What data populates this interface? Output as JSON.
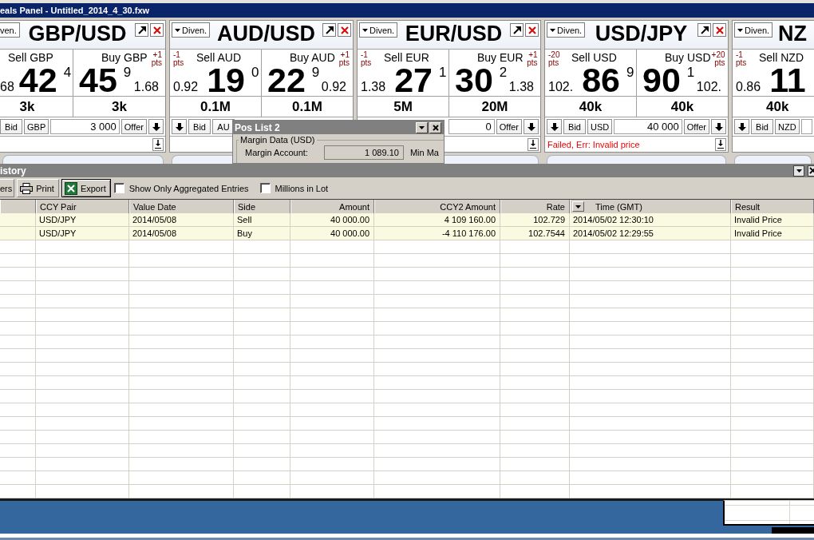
{
  "window": {
    "title": "eals Panel - Untitled_2014_4_30.fxw"
  },
  "tiles": [
    {
      "dropdown": "ven.",
      "pair": "GBP/USD",
      "header_buttons": [
        {
          "kind": "popout"
        },
        {
          "kind": "close"
        }
      ],
      "sell": {
        "label": "Sell GBP",
        "prefix": "68",
        "figure": "42",
        "pip": "4",
        "amount": "3k"
      },
      "buy": {
        "label": "Buy GBP",
        "pts": "+1 pts",
        "figure": "45",
        "pip": "9",
        "suffix": "1.68",
        "amount": "3k"
      },
      "controls": [
        {
          "kind": "button",
          "label": "Bid"
        },
        {
          "kind": "button",
          "label": "GBP"
        },
        {
          "kind": "field",
          "value": "3 000"
        },
        {
          "kind": "button",
          "label": "Offer"
        },
        {
          "kind": "arrow"
        }
      ],
      "status": [
        {
          "kind": "arrow"
        }
      ]
    },
    {
      "dropdown": "Diven.",
      "pair": "AUD/USD",
      "header_buttons": [
        {
          "kind": "popout"
        },
        {
          "kind": "close"
        }
      ],
      "sell": {
        "pts": "-1 pts",
        "label": "Sell AUD",
        "prefix": "0.92",
        "figure": "19",
        "pip": "0",
        "amount": "0.1M"
      },
      "buy": {
        "label": "Buy AUD",
        "pts": "+1 pts",
        "figure": "22",
        "pip": "9",
        "suffix": "0.92",
        "amount": "0.1M"
      },
      "controls": [
        {
          "kind": "arrow"
        },
        {
          "kind": "button",
          "label": "Bid"
        },
        {
          "kind": "button",
          "label": "AU"
        }
      ]
    },
    {
      "dropdown": "Diven.",
      "pair": "EUR/USD",
      "header_buttons": [
        {
          "kind": "popout"
        },
        {
          "kind": "close"
        }
      ],
      "sell": {
        "pts": "-1 pts",
        "label": "Sell EUR",
        "prefix": "1.38",
        "figure": "27",
        "pip": "1",
        "amount": "5M"
      },
      "buy": {
        "label": "Buy EUR",
        "pts": "+1 pts",
        "figure": "30",
        "pip": "2",
        "suffix": "1.38",
        "amount": "20M"
      },
      "controls": [
        {
          "kind": "field",
          "value": "0"
        },
        {
          "kind": "button",
          "label": "Offer"
        },
        {
          "kind": "arrow"
        }
      ],
      "status": [
        {
          "kind": "arrow"
        }
      ]
    },
    {
      "dropdown": "Diven.",
      "pair": "USD/JPY",
      "header_buttons": [
        {
          "kind": "popout"
        },
        {
          "kind": "close"
        }
      ],
      "sell": {
        "pts": "-20 pts",
        "label": "Sell USD",
        "prefix": "102.",
        "figure": "86",
        "pip": "9",
        "amount": "40k"
      },
      "buy": {
        "label": "Buy USD",
        "pts": "+20 pts",
        "figure": "90",
        "pip": "1",
        "suffix": "102.",
        "amount": "40k"
      },
      "controls": [
        {
          "kind": "arrow"
        },
        {
          "kind": "button",
          "label": "Bid"
        },
        {
          "kind": "button",
          "label": "USD"
        },
        {
          "kind": "field",
          "value": "40 000"
        },
        {
          "kind": "button",
          "label": "Offer"
        },
        {
          "kind": "arrow"
        }
      ],
      "status": [
        {
          "kind": "error",
          "text": "Failed, Err: Invalid price"
        },
        {
          "kind": "arrow"
        }
      ]
    },
    {
      "dropdown": "Diven.",
      "pair": "NZ",
      "sell": {
        "pts": "-1 pts",
        "label": "Sell NZD",
        "prefix": "0.86",
        "figure": "11",
        "amount": "40k"
      },
      "controls": [
        {
          "kind": "arrow"
        },
        {
          "kind": "button",
          "label": "Bid"
        },
        {
          "kind": "button",
          "label": "NZD"
        },
        {
          "kind": "field"
        }
      ]
    }
  ],
  "pos_list": {
    "title": "Pos List 2",
    "group": "Margin Data (USD)",
    "fields": [
      {
        "label": "Margin Account:",
        "value": "1 089.10"
      },
      {
        "label": "Min Ma"
      }
    ]
  },
  "history": {
    "title": "istory",
    "buttons": [
      {
        "kind": "plain",
        "label": "ers",
        "focused": false
      },
      {
        "kind": "print",
        "label": "Print",
        "focused": false
      },
      {
        "kind": "export",
        "label": "Export",
        "focused": true
      }
    ],
    "checkboxes": [
      {
        "label": "Show Only Aggregated Entries",
        "checked": false
      },
      {
        "label": "Millions in Lot",
        "checked": false
      }
    ],
    "table": {
      "columns": [
        {
          "label": "CCY Pair",
          "kind": "text",
          "dropdown": false
        },
        {
          "label": "Value Date",
          "kind": "text",
          "dropdown": false
        },
        {
          "label": "Side",
          "kind": "text",
          "dropdown": false
        },
        {
          "label": "Amount",
          "kind": "number",
          "dropdown": false
        },
        {
          "label": "CCY2 Amount",
          "kind": "number",
          "dropdown": false
        },
        {
          "label": "Rate",
          "kind": "number",
          "dropdown": false
        },
        {
          "label": "Time (GMT)",
          "kind": "text",
          "dropdown": true
        },
        {
          "label": "Result",
          "kind": "text",
          "dropdown": false
        }
      ],
      "rows": [
        {
          "cells": [
            "USD/JPY",
            "2014/05/08",
            "Sell",
            "40 000.00",
            "4 109 160.00",
            "102.729",
            "2014/05/02 12:30:10",
            "Invalid Price"
          ]
        },
        {
          "cells": [
            "USD/JPY",
            "2014/05/08",
            "Buy",
            "40 000.00",
            "-4 110 176.00",
            "102.7544",
            "2014/05/02 12:29:55",
            "Invalid Price"
          ]
        }
      ]
    }
  }
}
